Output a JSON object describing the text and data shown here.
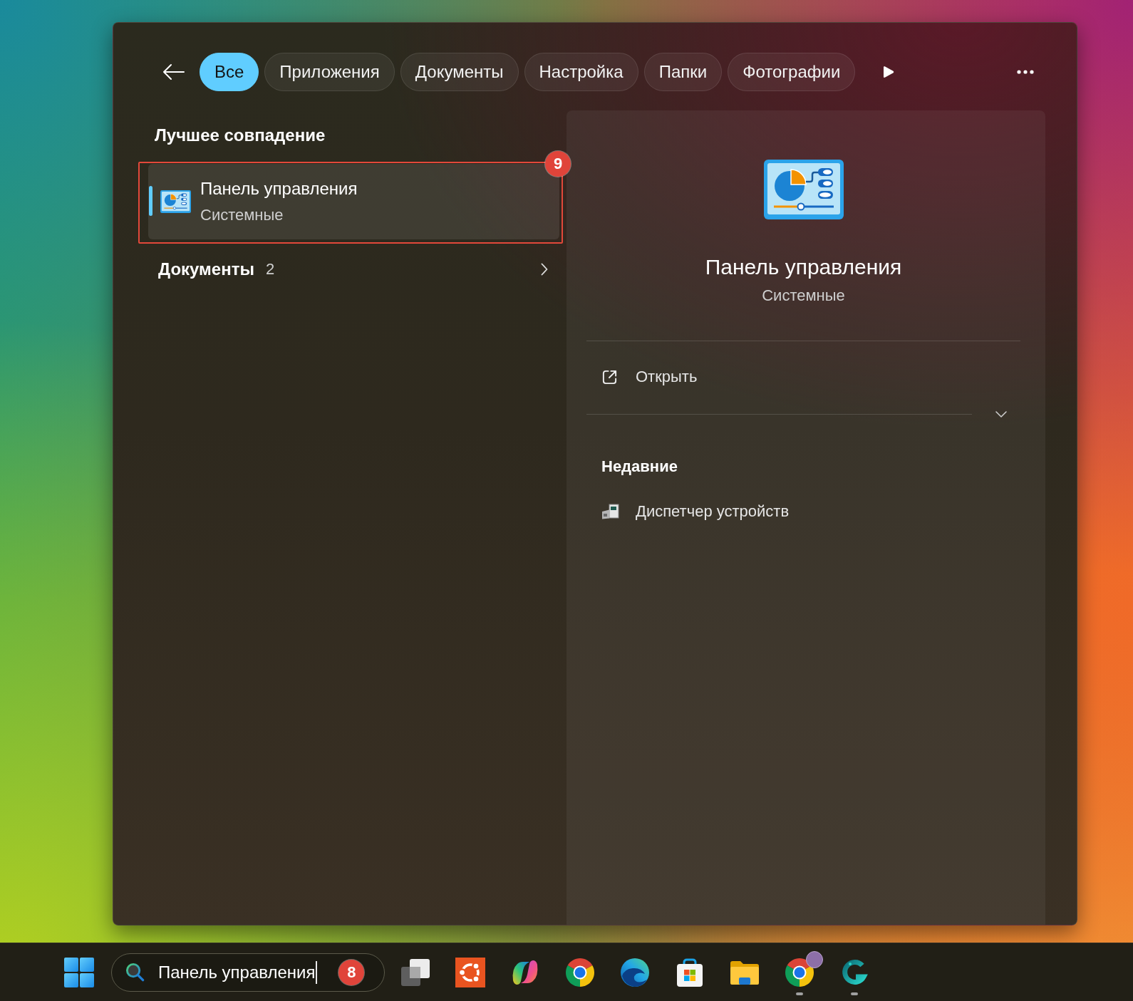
{
  "filter_tabs": [
    {
      "label": "Все",
      "selected": true
    },
    {
      "label": "Приложения",
      "selected": false
    },
    {
      "label": "Документы",
      "selected": false
    },
    {
      "label": "Настройка",
      "selected": false
    },
    {
      "label": "Папки",
      "selected": false
    },
    {
      "label": "Фотографии",
      "selected": false
    }
  ],
  "results": {
    "section_title": "Лучшее совпадение",
    "best_match": {
      "title": "Панель управления",
      "subtitle": "Системные",
      "selected": true,
      "highlighted": true,
      "callout": "9"
    },
    "groups": [
      {
        "label": "Документы",
        "count": "2"
      }
    ]
  },
  "details": {
    "title": "Панель управления",
    "subtitle": "Системные",
    "actions": [
      {
        "label": "Открыть"
      }
    ],
    "expanded": false,
    "recent_title": "Недавние",
    "recent": [
      {
        "label": "Диспетчер устройств"
      }
    ]
  },
  "taskbar": {
    "search": {
      "value": "Панель управления",
      "focused": true,
      "callout": "8"
    },
    "apps": [
      {
        "kind": "task-view",
        "running": false
      },
      {
        "kind": "ubuntu",
        "running": false
      },
      {
        "kind": "copilot",
        "running": false
      },
      {
        "kind": "chrome",
        "running": false
      },
      {
        "kind": "edge",
        "running": false
      },
      {
        "kind": "store",
        "running": false
      },
      {
        "kind": "folder",
        "running": false
      },
      {
        "kind": "chrome-profile",
        "running": true
      },
      {
        "kind": "g-app",
        "running": true
      }
    ]
  }
}
